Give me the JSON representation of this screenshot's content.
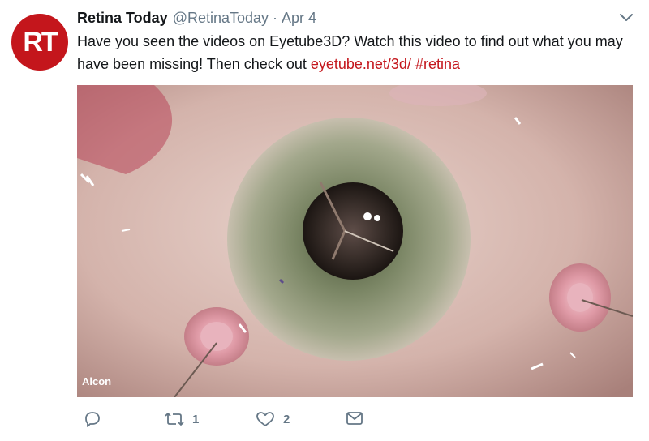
{
  "tweet": {
    "avatar_text": "RT",
    "author_name": "Retina Today",
    "handle": "@RetinaToday",
    "separator": "·",
    "date": "Apr 4",
    "text_intro": "Have you seen the videos on Eyetube3D? Watch this video to find out what you may have been missing! Then check out ",
    "link_url_text": "eyetube.net/3d/",
    "hashtag": "#retina",
    "media": {
      "watermark": "Alcon",
      "description_icon": "surgical-video-thumbnail"
    },
    "actions": {
      "reply_icon": "reply-icon",
      "retweet_icon": "retweet-icon",
      "retweet_count": "1",
      "like_icon": "heart-icon",
      "like_count": "2",
      "dm_icon": "envelope-icon"
    }
  },
  "colors": {
    "brand": "#c4161c",
    "secondary_text": "#657786",
    "primary_text": "#14171a"
  }
}
